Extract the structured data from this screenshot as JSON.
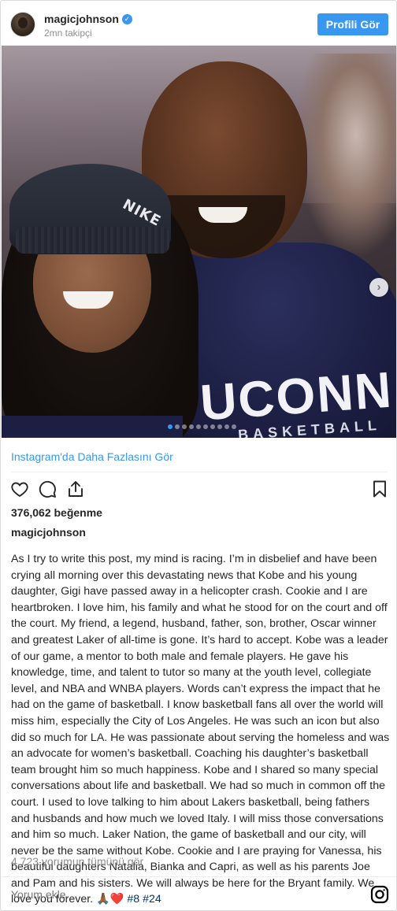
{
  "header": {
    "username": "magicjohnson",
    "followers": "2mn takipçi",
    "profile_button": "Profili Gör"
  },
  "photo": {
    "shirt_text": "UCONN",
    "shirt_sub": "BASKETBALL",
    "beanie_text": "NIKE",
    "carousel_count": 10,
    "carousel_active": 0
  },
  "see_more_link": "Instagram'da Daha Fazlasını Gör",
  "actions": {
    "like_icon": "heart-icon",
    "comment_icon": "comment-icon",
    "share_icon": "share-icon",
    "save_icon": "bookmark-icon"
  },
  "likes": "376,062 beğenme",
  "owner": "magicjohnson",
  "caption": "As I try to write this post, my mind is racing. I’m in disbelief and have been crying all morning over this devastating news that Kobe and his young daughter, Gigi have passed away in a helicopter crash. Cookie and I are heartbroken. I love him, his family and what he stood for on the court and off the court. My friend, a legend, husband, father, son, brother, Oscar winner and greatest Laker of all-time is gone. It’s hard to accept. Kobe was a leader of our game, a mentor to both male and female players. He gave his knowledge, time, and talent to tutor so many at the youth level, collegiate level, and NBA and WNBA players. Words can’t express the impact that he had on the game of basketball. I know basketball fans all over the world will miss him, especially the City of Los Angeles. He was such an icon but also did so much for LA. He was passionate about serving the homeless and was an advocate for women’s basketball. Coaching his daughter’s basketball team brought him so much happiness. Kobe and I shared so many special conversations about life and basketball. We had so much in common off the court. I used to love talking to him about Lakers basketball, being fathers and husbands and how much we loved Italy. I will miss those conversations and him so much. Laker Nation, the game of basketball and our city, will never be the same without Kobe. Cookie and I are praying for Vanessa, his beautiful daughters Natalia, Bianka and Capri, as well as his parents Joe and Pam and his sisters. We will always be here for the Bryant family. We love you forever. 🙏🏾❤️",
  "hashtags": [
    "#8",
    "#24"
  ],
  "view_comments": "4,723 yorumun tümünü gör",
  "comment_placeholder": "Yorum ekle...",
  "colors": {
    "accent": "#3897f0",
    "muted": "#8e8e8e",
    "text": "#262626"
  }
}
